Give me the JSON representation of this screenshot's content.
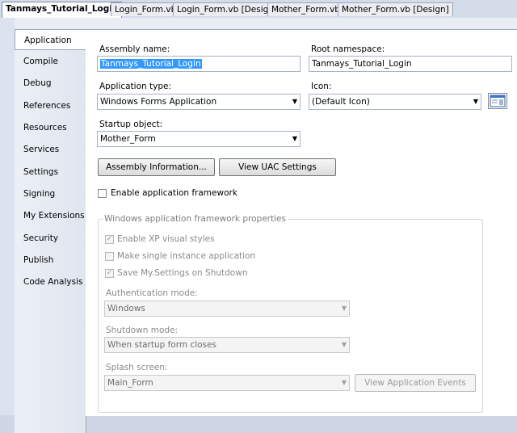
{
  "tabs": [
    {
      "label": "Tanmays_Tutorial_Login",
      "active": true
    },
    {
      "label": "Login_Form.vb"
    },
    {
      "label": "Login_Form.vb [Design]"
    },
    {
      "label": "Mother_Form.vb"
    },
    {
      "label": "Mother_Form.vb [Design]"
    }
  ],
  "sidebar": {
    "items": [
      {
        "label": "Application",
        "active": true
      },
      {
        "label": "Compile"
      },
      {
        "label": "Debug"
      },
      {
        "label": "References"
      },
      {
        "label": "Resources"
      },
      {
        "label": "Services"
      },
      {
        "label": "Settings"
      },
      {
        "label": "Signing"
      },
      {
        "label": "My Extensions"
      },
      {
        "label": "Security"
      },
      {
        "label": "Publish"
      },
      {
        "label": "Code Analysis"
      }
    ]
  },
  "form": {
    "assembly_name_label": "Assembly name:",
    "assembly_name_value": "Tanmays_Tutorial_Login",
    "root_namespace_label": "Root namespace:",
    "root_namespace_value": "Tanmays_Tutorial_Login",
    "application_type_label": "Application type:",
    "application_type_value": "Windows Forms Application",
    "icon_label": "Icon:",
    "icon_value": "(Default Icon)",
    "startup_object_label": "Startup object:",
    "startup_object_value": "Mother_Form",
    "assembly_info_button": "Assembly Information...",
    "view_uac_button": "View UAC Settings",
    "enable_framework_label": "Enable application framework",
    "enable_framework_checked": false
  },
  "framework": {
    "title": "Windows application framework properties",
    "enable_xp_label": "Enable XP visual styles",
    "enable_xp_checked": true,
    "single_instance_label": "Make single instance application",
    "single_instance_checked": false,
    "save_settings_label": "Save My.Settings on Shutdown",
    "save_settings_checked": true,
    "auth_mode_label": "Authentication mode:",
    "auth_mode_value": "Windows",
    "shutdown_mode_label": "Shutdown mode:",
    "shutdown_mode_value": "When startup form closes",
    "splash_label": "Splash screen:",
    "splash_value": "Main_Form",
    "view_events_button": "View Application Events"
  },
  "glyphs": {
    "check": "✓",
    "dropdown": "▼"
  }
}
